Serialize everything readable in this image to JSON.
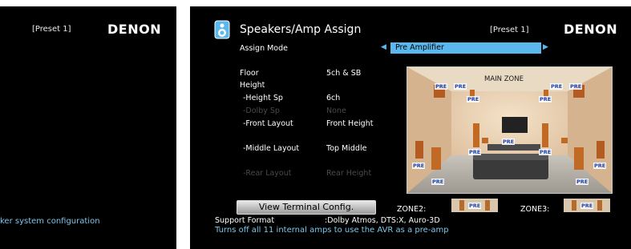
{
  "left_screen": {
    "preset": "[Preset 1]",
    "brand": "DENON",
    "hint_text": "ker system configuration"
  },
  "right_screen": {
    "title": "Speakers/Amp Assign",
    "preset": "[Preset 1]",
    "brand": "DENON",
    "icon": "speaker-icon",
    "assign_mode": {
      "label": "Assign Mode",
      "value": "Pre Amplifier"
    },
    "rows": [
      {
        "label": "Floor",
        "value": "5ch & SB",
        "enabled": true
      },
      {
        "label": "Height",
        "value": "",
        "enabled": true
      },
      {
        "label": "-Height Sp",
        "value": "6ch",
        "enabled": true
      },
      {
        "label": "-Dolby Sp",
        "value": "None",
        "enabled": false
      },
      {
        "label": "-Front Layout",
        "value": "Front Height",
        "enabled": true
      },
      {
        "label": "-Middle Layout",
        "value": "Top Middle",
        "enabled": true
      },
      {
        "label": "-Rear Layout",
        "value": "Rear Height",
        "enabled": false
      }
    ],
    "diagram": {
      "zone_title": "MAIN ZONE",
      "badge": "PRE"
    },
    "view_button": "View Terminal Config.",
    "zone2": "ZONE2:",
    "zone3": "ZONE3:",
    "support_format": {
      "label": "Support Format",
      "value": ":Dolby Atmos, DTS:X, Auro-3D"
    },
    "hint_text": "Turns off all 11 internal amps to use the AVR as a pre-amp"
  },
  "colors": {
    "background": "#000000",
    "highlight": "#5ab8ee",
    "hint": "#7ec6ec",
    "disabled": "#4a4a4a",
    "badge_text": "#1b3fa8"
  }
}
